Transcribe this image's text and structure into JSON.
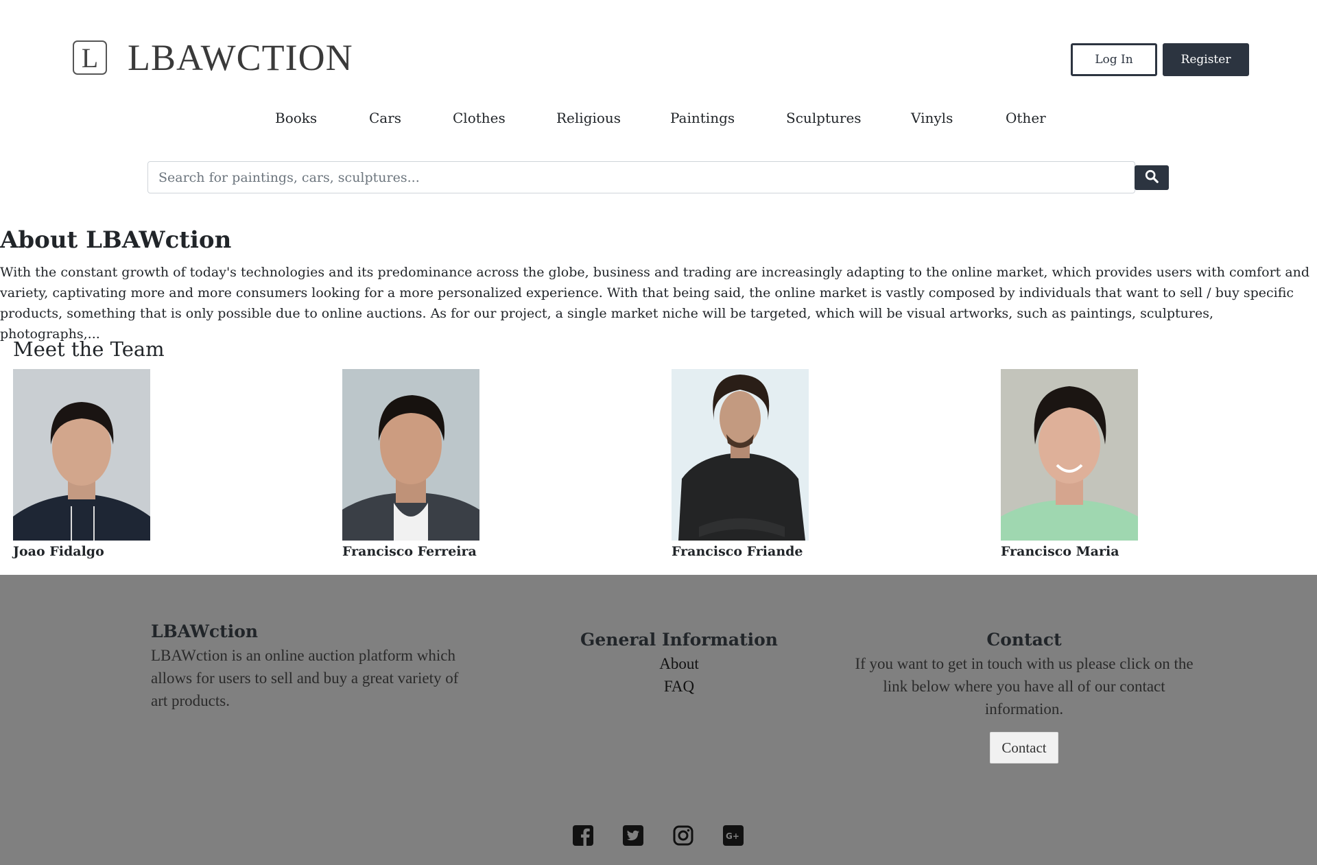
{
  "header": {
    "logo_letter": "L",
    "logo_text": "LBAWCTION",
    "login_label": "Log In",
    "register_label": "Register"
  },
  "nav": {
    "items": [
      "Books",
      "Cars",
      "Clothes",
      "Religious",
      "Paintings",
      "Sculptures",
      "Vinyls",
      "Other"
    ]
  },
  "search": {
    "placeholder": "Search for paintings, cars, sculptures...",
    "value": ""
  },
  "about": {
    "title": "About LBAWction",
    "text": "With the constant growth of today's technologies and its predominance across the globe, business and trading are increasingly adapting to the online market, which provides users with comfort and variety, captivating more and more consumers looking for a more personalized experience. With that being said, the online market is vastly composed by individuals that want to sell / buy specific products, something that is only possible due to online auctions. As for our project, a single market niche will be targeted, which will be visual artworks, such as paintings, sculptures, photographs,..."
  },
  "team": {
    "title": "Meet the Team",
    "members": [
      {
        "name": "Joao Fidalgo"
      },
      {
        "name": "Francisco Ferreira"
      },
      {
        "name": "Francisco Friande"
      },
      {
        "name": "Francisco Maria"
      }
    ]
  },
  "footer": {
    "brand_title": "LBAWction",
    "brand_text": "LBAWction is an online auction platform which allows for users to sell and buy a great variety of art products.",
    "info_title": "General Information",
    "info_links": [
      "About",
      "FAQ"
    ],
    "contact_title": "Contact",
    "contact_text": "If you want to get in touch with us please click on the link below where you have all of our contact information.",
    "contact_button": "Contact",
    "social_icons": [
      "facebook-icon",
      "twitter-icon",
      "instagram-icon",
      "google-plus-icon"
    ]
  },
  "colors": {
    "primary_dark": "#2c3440",
    "footer_bg": "#808080",
    "text": "#212529"
  }
}
